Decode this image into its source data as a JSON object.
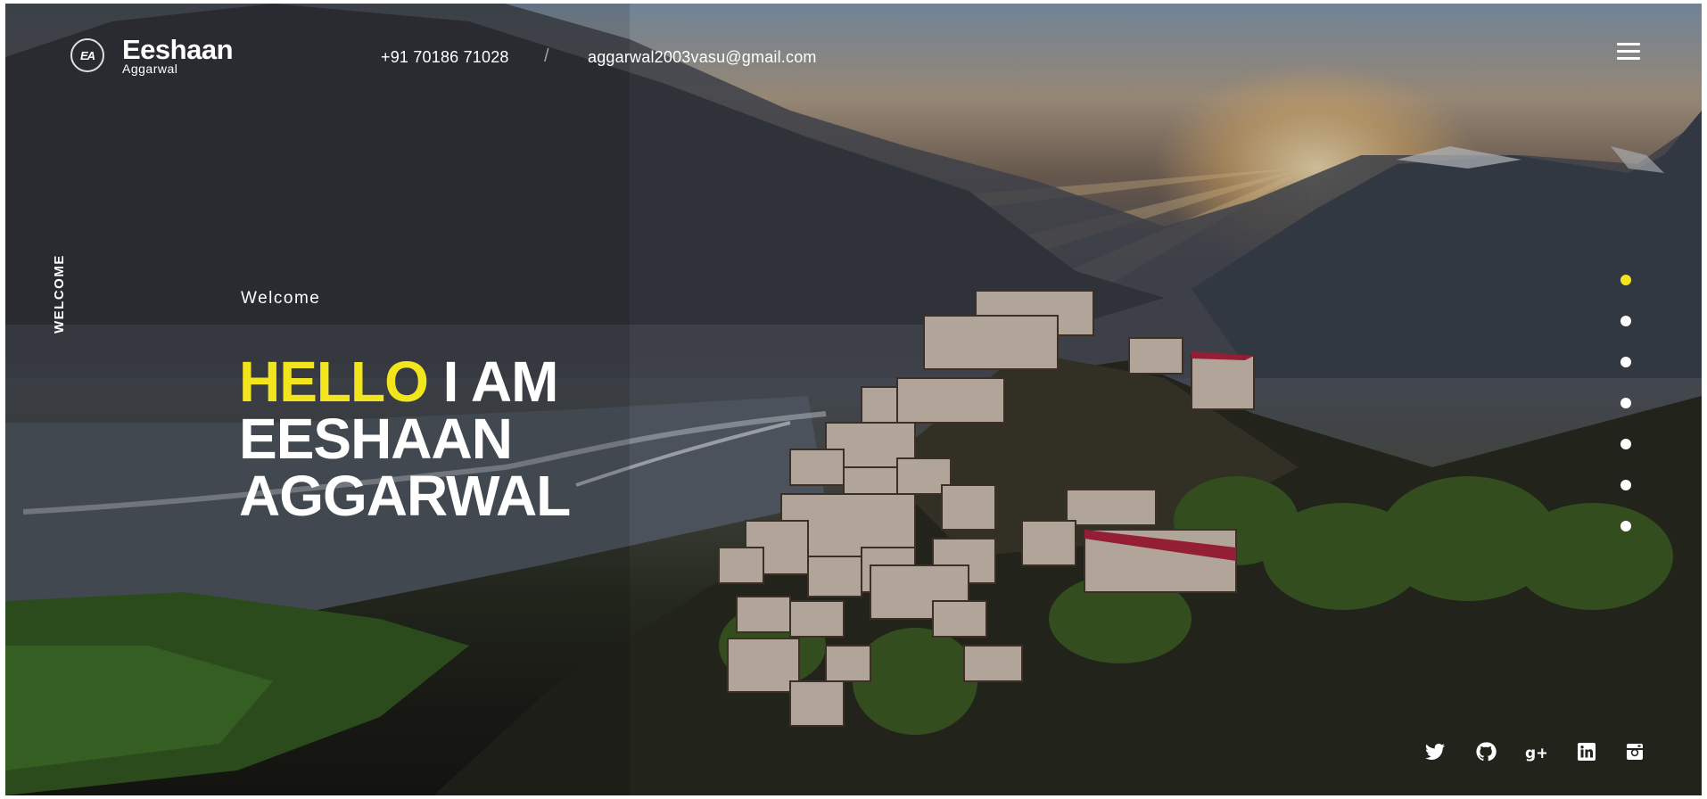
{
  "header": {
    "logo_mark": "EA",
    "logo_name": "Eeshaan",
    "logo_sub": "Aggarwal",
    "phone": "+91 70186 71028",
    "separator": "/",
    "email": "aggarwal2003vasu@gmail.com",
    "menu_icon": "hamburger-menu-icon"
  },
  "hero": {
    "vertical_label": "WELCOME",
    "welcome": "Welcome",
    "highlight": "HELLO",
    "line1_rest": " I AM",
    "line2": "EESHAAN",
    "line3": "AGGARWAL",
    "highlight_color": "#f3e51d"
  },
  "pagination": {
    "count": 7,
    "active_index": 0,
    "active_color": "#f3e51d"
  },
  "social": [
    {
      "icon": "twitter-icon"
    },
    {
      "icon": "github-icon"
    },
    {
      "icon": "google-plus-icon"
    },
    {
      "icon": "linkedin-icon"
    },
    {
      "icon": "instagram-icon"
    }
  ]
}
